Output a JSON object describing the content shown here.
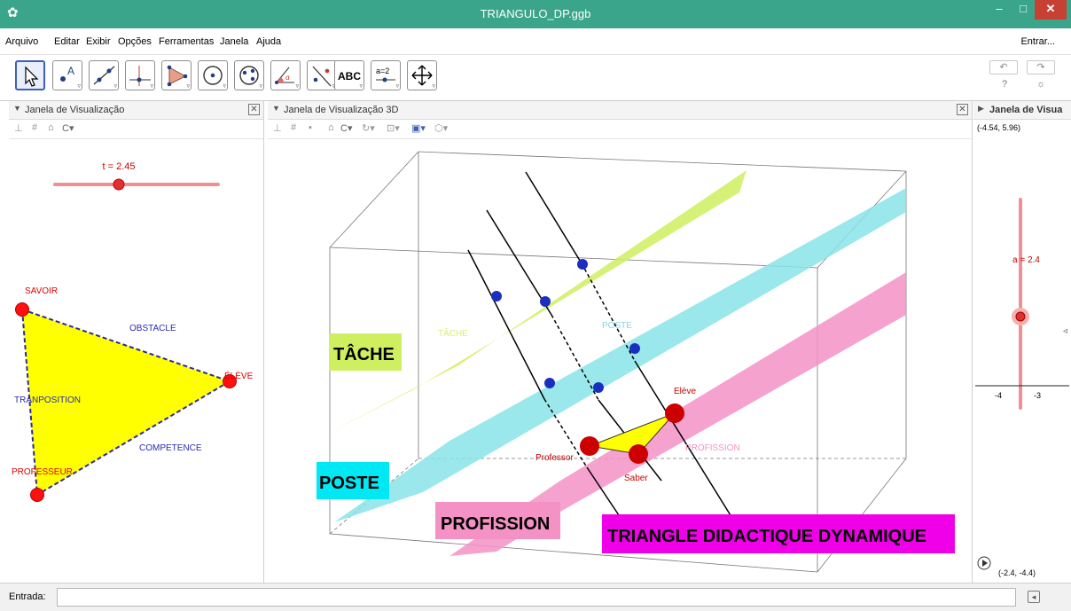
{
  "window": {
    "title": "TRIANGULO_DP.ggb",
    "minimize": "–",
    "maximize": "□",
    "close": "✕"
  },
  "menu": {
    "items": [
      "Arquivo",
      "Editar",
      "Exibir",
      "Opções",
      "Ferramentas",
      "Janela",
      "Ajuda"
    ],
    "login": "Entrar..."
  },
  "toolbar": {
    "tools": [
      {
        "name": "move-tool",
        "icon": "arrow-pointer-icon"
      },
      {
        "name": "point-tool",
        "icon": "point-icon"
      },
      {
        "name": "line-tool",
        "icon": "line-icon"
      },
      {
        "name": "perpendicular-tool",
        "icon": "perpendicular-icon"
      },
      {
        "name": "polygon-tool",
        "icon": "polygon-icon"
      },
      {
        "name": "circle-tool",
        "icon": "circle-icon"
      },
      {
        "name": "ellipse-tool",
        "icon": "ellipse-icon"
      },
      {
        "name": "angle-tool",
        "icon": "angle-icon"
      },
      {
        "name": "reflect-tool",
        "icon": "reflect-icon"
      },
      {
        "name": "text-tool",
        "label": "ABC"
      },
      {
        "name": "slider-tool",
        "label": "a=2"
      },
      {
        "name": "move-graphics-tool",
        "icon": "move-arrows-icon"
      }
    ],
    "undo": "↶",
    "redo": "↷",
    "help": "?",
    "settings": "☼"
  },
  "panels": {
    "left": {
      "title": "Janela de Visualização",
      "slider_label": "t = 2.45",
      "slider_value": 0.4,
      "labels": {
        "savoir": "SAVOIR",
        "obstacle": "OBSTACLE",
        "eleve": "ÉLÈVE",
        "tranposition": "TRANPOSITION",
        "competence": "COMPETENCE",
        "professeur": "PROFESSEUR"
      }
    },
    "view3d": {
      "title": "Janela de Visualização 3D",
      "labels": {
        "tache_box": "TÂCHE",
        "poste_box": "POSTE",
        "profission_box": "PROFISSION",
        "title_box": "TRIANGLE DIDACTIQUE DYNAMIQUE",
        "tache_plane": "TÂCHE",
        "poste_plane": "POSTE",
        "profission_plane": "PROFISSION",
        "eleve": "Elève",
        "professor": "Professor",
        "saber": "Saber"
      },
      "colors": {
        "tache": "#cfef60",
        "poste": "#88e4e8",
        "profission": "#f492c6",
        "title_bg": "#f000e8"
      }
    },
    "right": {
      "title": "Janela de Visua",
      "corner_top": "(-4.54, 5.96)",
      "corner_bottom": "(-2.4, -4.4)",
      "slider_label": "a = 2.4",
      "ticks": [
        "-4",
        "-3"
      ]
    }
  },
  "input": {
    "label": "Entrada:",
    "value": "",
    "placeholder": ""
  }
}
